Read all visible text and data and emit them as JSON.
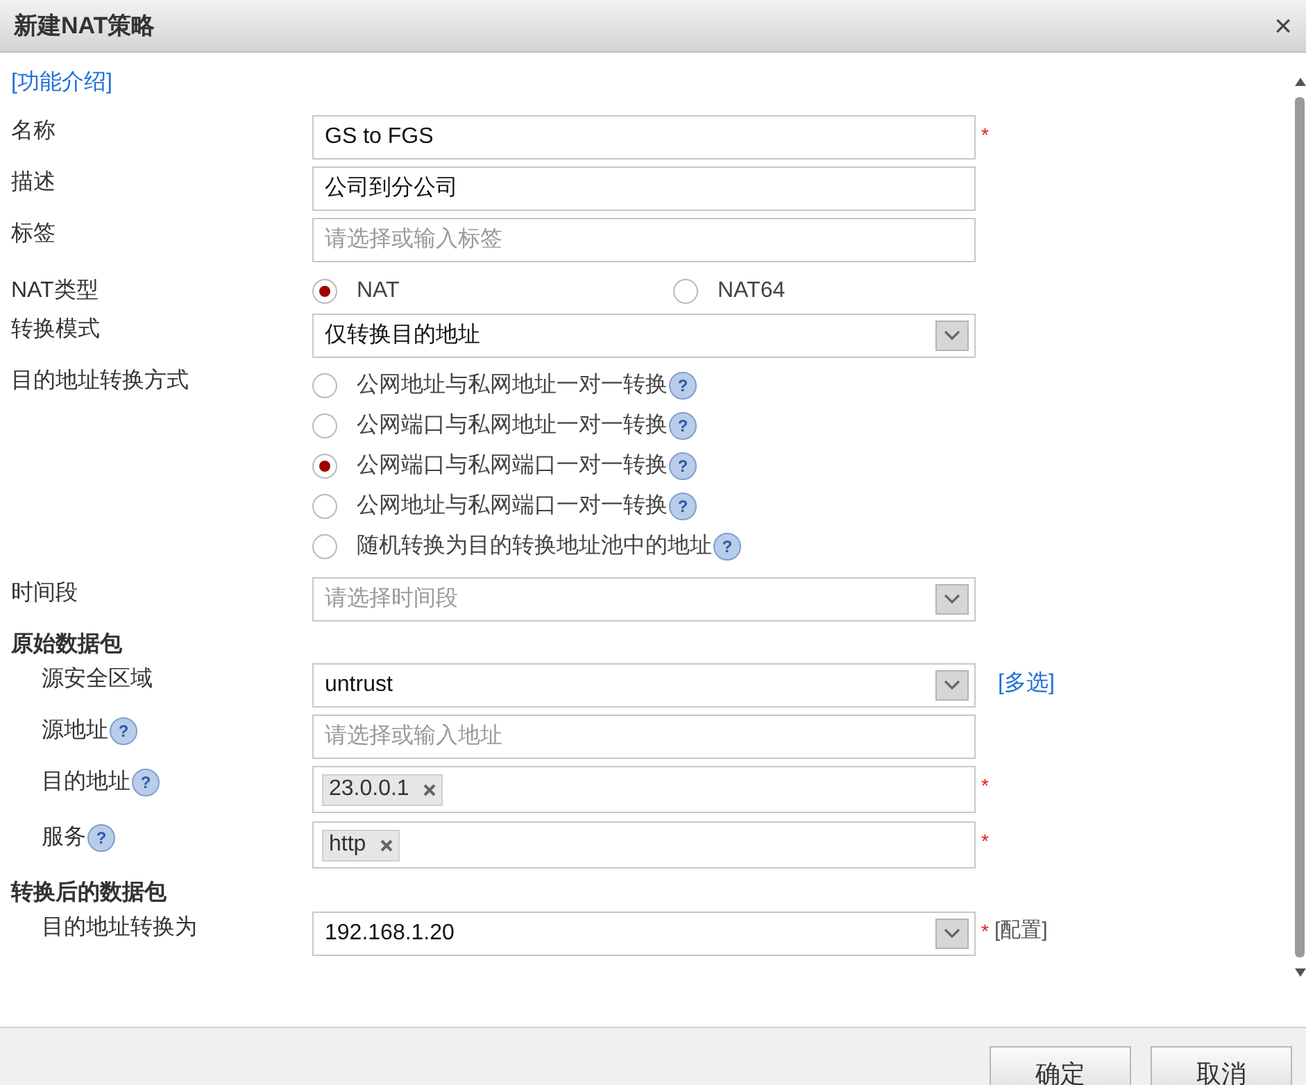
{
  "window": {
    "title": "新建NAT策略",
    "close": "×"
  },
  "intro_link": "[功能介绍]",
  "rows": [
    {
      "kind": "text",
      "label": "名称",
      "value": "GS to FGS",
      "required": "*"
    },
    {
      "kind": "text",
      "label": "描述",
      "value": "公司到分公司"
    },
    {
      "kind": "text",
      "label": "标签",
      "placeholder": "请选择或输入标签"
    },
    {
      "kind": "radio_inline",
      "label": "NAT类型",
      "options": [
        {
          "label": "NAT",
          "selected": true
        },
        {
          "label": "NAT64",
          "selected": false
        }
      ]
    },
    {
      "kind": "select",
      "label": "转换模式",
      "value": "仅转换目的地址"
    },
    {
      "kind": "radio_list",
      "label": "目的地址转换方式",
      "options": [
        {
          "label": "公网地址与私网地址一对一转换",
          "selected": false,
          "help": "?"
        },
        {
          "label": "公网端口与私网地址一对一转换",
          "selected": false,
          "help": "?"
        },
        {
          "label": "公网端口与私网端口一对一转换",
          "selected": true,
          "help": "?"
        },
        {
          "label": "公网地址与私网端口一对一转换",
          "selected": false,
          "help": "?"
        },
        {
          "label": "随机转换为目的转换地址池中的地址",
          "selected": false,
          "help": "?"
        }
      ]
    },
    {
      "kind": "select",
      "label": "时间段",
      "placeholder": "请选择时间段"
    },
    {
      "kind": "section",
      "label": "原始数据包"
    },
    {
      "kind": "select",
      "label": "源安全区域",
      "value": "untrust",
      "sub": true,
      "link": "[多选]"
    },
    {
      "kind": "text",
      "label": "源地址",
      "placeholder": "请选择或输入地址",
      "sub": true,
      "help": "?"
    },
    {
      "kind": "tags",
      "label": "目的地址",
      "tags": [
        "23.0.0.1"
      ],
      "sub": true,
      "help": "?",
      "required": "*"
    },
    {
      "kind": "tags",
      "label": "服务",
      "tags": [
        "http"
      ],
      "sub": true,
      "help": "?",
      "required": "*"
    },
    {
      "kind": "section",
      "label": "转换后的数据包"
    },
    {
      "kind": "select",
      "label": "目的地址转换为",
      "value": "192.168.1.20",
      "sub": true,
      "required": "*",
      "note": "[配置]"
    }
  ],
  "buttons": [
    "确定",
    "取消"
  ]
}
